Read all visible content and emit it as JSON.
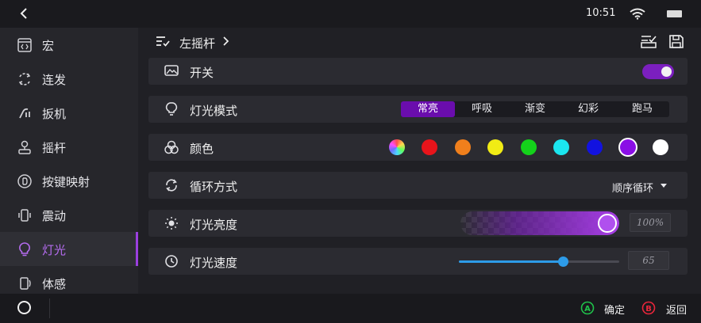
{
  "status": {
    "time": "10:51"
  },
  "sidebar": {
    "items": [
      {
        "label": "宏"
      },
      {
        "label": "连发"
      },
      {
        "label": "扳机"
      },
      {
        "label": "摇杆"
      },
      {
        "label": "按键映射"
      },
      {
        "label": "震动"
      },
      {
        "label": "灯光",
        "active": true
      },
      {
        "label": "体感"
      }
    ]
  },
  "header": {
    "breadcrumb": "左摇杆"
  },
  "rows": {
    "switch": {
      "label": "开关",
      "on": true
    },
    "light_mode": {
      "label": "灯光模式",
      "options": [
        "常亮",
        "呼吸",
        "渐变",
        "幻彩",
        "跑马"
      ],
      "selected": "常亮"
    },
    "color": {
      "label": "颜色",
      "swatches": [
        "rainbow",
        "#e8141b",
        "#f07f1c",
        "#f1ec15",
        "#14d21b",
        "#1be6ef",
        "#1212e0",
        "#8a0ee6",
        "#ffffff"
      ],
      "selected_index": 7
    },
    "cycle": {
      "label": "循环方式",
      "value": "顺序循环"
    },
    "brightness": {
      "label": "灯光亮度",
      "value": 1.0,
      "display": "100%"
    },
    "speed": {
      "label": "灯光速度",
      "value": 65,
      "max": 100,
      "display": "65"
    }
  },
  "bottom": {
    "confirm_key": "A",
    "confirm_label": "确定",
    "back_key": "B",
    "back_label": "返回"
  },
  "colors": {
    "accent": "#9b3fe0",
    "toggle": "#7b1fbf",
    "slider_blue": "#2d9be8",
    "confirm_green": "#1fc24a",
    "back_red": "#e8263b"
  }
}
